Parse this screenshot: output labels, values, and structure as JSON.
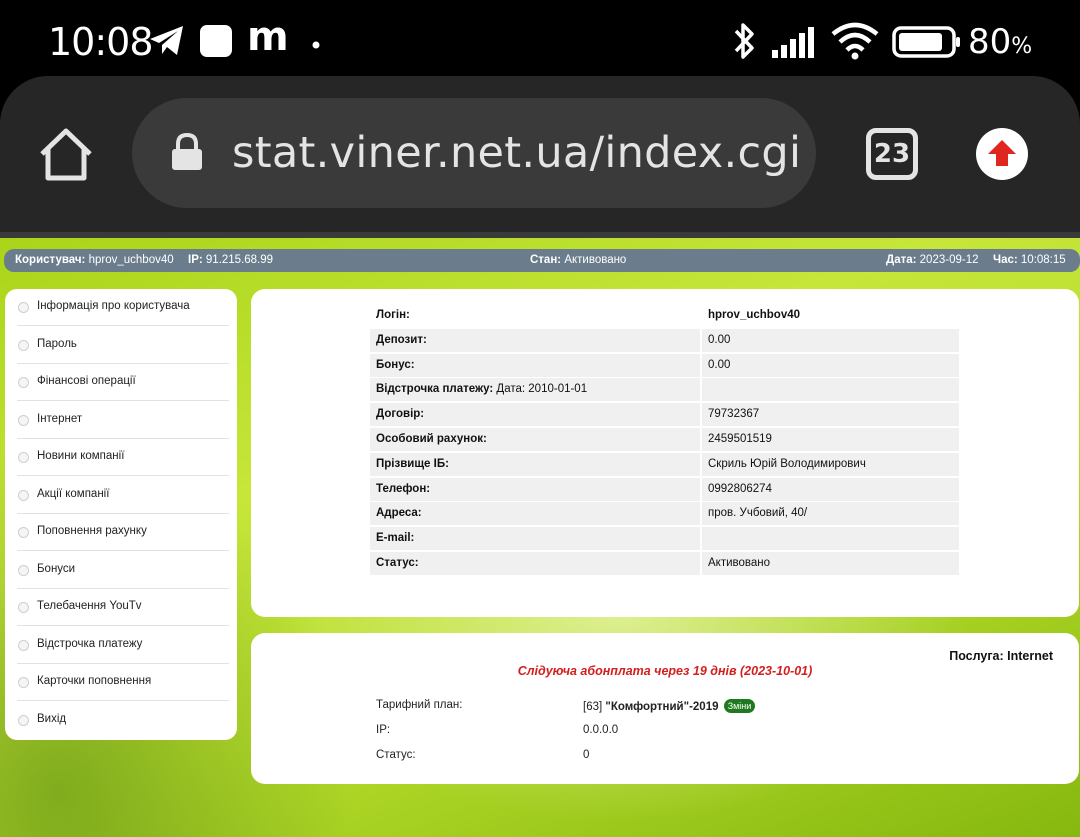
{
  "statusbar": {
    "time": "10:08",
    "notif_letter": "m",
    "battery_pct": "80",
    "battery_unit": "%"
  },
  "browser": {
    "url": "stat.viner.net.ua/index.cgi",
    "tab_count": "23"
  },
  "infobar": {
    "user_label": "Користувач:",
    "user_value": "hprov_uchbov40",
    "ip_label": "IP:",
    "ip_value": "91.215.68.99",
    "state_label": "Стан:",
    "state_value": "Активовано",
    "date_label": "Дата:",
    "date_value": "2023-09-12",
    "time_label": "Час:",
    "time_value": "10:08:15"
  },
  "sidebar": {
    "items": [
      "Інформація про користувача",
      "Пароль",
      "Фінансові операції",
      "Інтернет",
      "Новини компанії",
      "Акції компанії",
      "Поповнення рахунку",
      "Бонуси",
      "Телебачення YouTv",
      "Відстрочка платежу",
      "Карточки поповнення",
      "Вихід"
    ]
  },
  "user_info": {
    "login_label": "Логін:",
    "login_value": "hprov_uchbov40",
    "deposit_label": "Депозит:",
    "deposit_value": "0.00",
    "bonus_label": "Бонус:",
    "bonus_value": "0.00",
    "deferral_label": "Відстрочка платежу:",
    "deferral_date": "Дата: 2010-01-01",
    "deferral_value": "",
    "contract_label": "Договір:",
    "contract_value": "79732367",
    "account_label": "Особовий рахунок:",
    "account_value": "2459501519",
    "name_label": "Прізвище ІБ:",
    "name_value": "Скриль Юрій Володимирович",
    "phone_label": "Телефон:",
    "phone_value": "0992806274",
    "address_label": "Адреса:",
    "address_value": "пров. Учбовий, 40/",
    "email_label": "E-mail:",
    "email_value": "",
    "status_label": "Статус:",
    "status_value": "Активовано"
  },
  "service": {
    "title": "Послуга: Internet",
    "next_fee": "Слідуюча абонплата через 19 днів (2023-10-01)",
    "plan_label": "Тарифний план:",
    "plan_prefix": "[63]",
    "plan_name": "\"Комфортний\"-2019",
    "change_label": "Зміни",
    "ip_label": "IP:",
    "ip_value": "0.0.0.0",
    "status_label": "Статус:",
    "status_value": "0"
  }
}
